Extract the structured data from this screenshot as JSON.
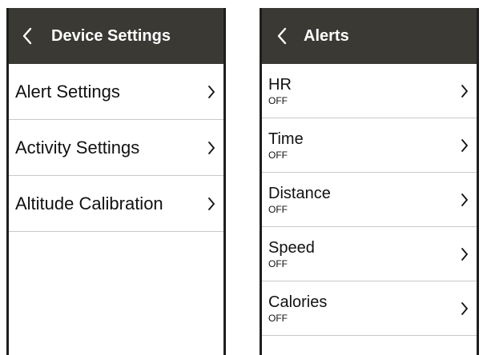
{
  "left_screen": {
    "title": "Device Settings",
    "back_icon": "chevron-left-icon",
    "items": [
      {
        "label": "Alert Settings"
      },
      {
        "label": "Activity Settings"
      },
      {
        "label": "Altitude Calibration"
      }
    ]
  },
  "right_screen": {
    "title": "Alerts",
    "back_icon": "chevron-left-icon",
    "items": [
      {
        "label": "HR",
        "value": "OFF"
      },
      {
        "label": "Time",
        "value": "OFF"
      },
      {
        "label": "Distance",
        "value": "OFF"
      },
      {
        "label": "Speed",
        "value": "OFF"
      },
      {
        "label": "Calories",
        "value": "OFF"
      }
    ]
  },
  "colors": {
    "header_bg": "#3a3934",
    "header_text": "#ffffff",
    "divider": "#c8c8c8",
    "frame": "#1e1e1e"
  }
}
